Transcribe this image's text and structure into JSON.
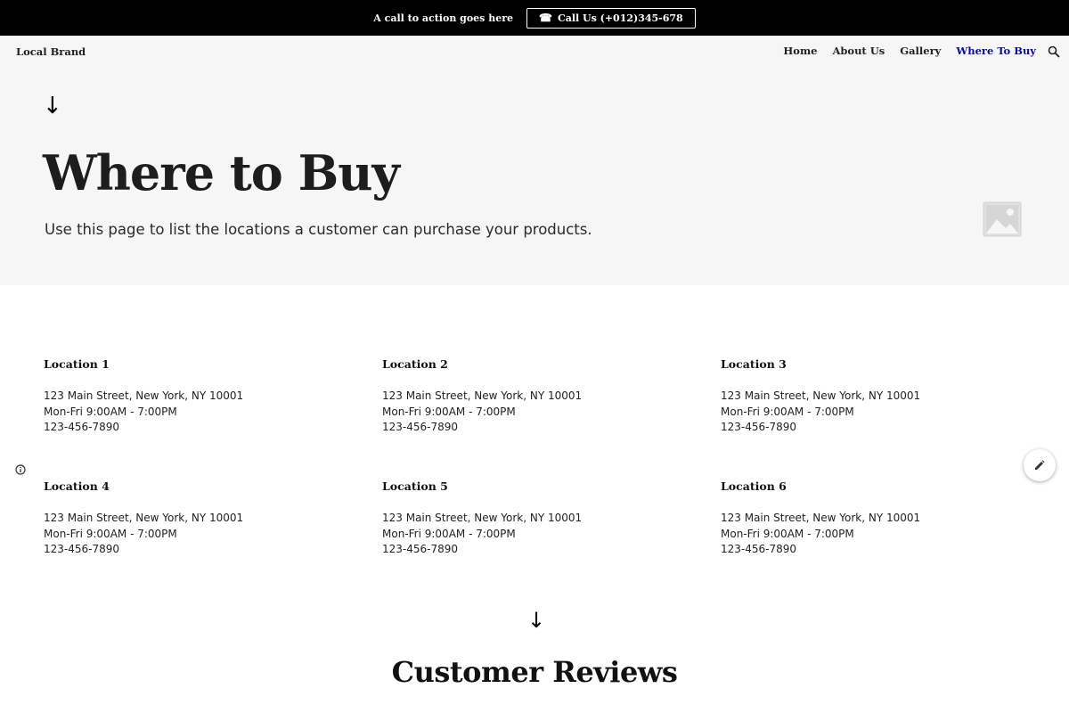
{
  "topbar": {
    "cta_text": "A call to action goes here",
    "call_label": "Call Us (+012)345-678",
    "phone_icon": "☎"
  },
  "header": {
    "brand": "Local Brand",
    "nav": [
      "Home",
      "About Us",
      "Gallery",
      "Where To Buy"
    ],
    "active_nav": "Where To Buy",
    "active_color": "#0b0b9e"
  },
  "hero": {
    "arrow": "↓",
    "title": "Where to Buy",
    "subtitle": "Use this page to list the locations a customer can purchase your products."
  },
  "locations": [
    {
      "name": "Location 1",
      "address": "123 Main Street, New York, NY 10001",
      "hours": "Mon-Fri 9:00AM - 7:00PM",
      "phone": "123-456-7890"
    },
    {
      "name": "Location 2",
      "address": "123 Main Street, New York, NY 10001",
      "hours": "Mon-Fri 9:00AM - 7:00PM",
      "phone": "123-456-7890"
    },
    {
      "name": "Location 3",
      "address": "123 Main Street, New York, NY 10001",
      "hours": "Mon-Fri 9:00AM - 7:00PM",
      "phone": "123-456-7890"
    },
    {
      "name": "Location 4",
      "address": "123 Main Street, New York, NY 10001",
      "hours": "Mon-Fri 9:00AM - 7:00PM",
      "phone": "123-456-7890"
    },
    {
      "name": "Location 5",
      "address": "123 Main Street, New York, NY 10001",
      "hours": "Mon-Fri 9:00AM - 7:00PM",
      "phone": "123-456-7890"
    },
    {
      "name": "Location 6",
      "address": "123 Main Street, New York, NY 10001",
      "hours": "Mon-Fri 9:00AM - 7:00PM",
      "phone": "123-456-7890"
    }
  ],
  "reviews": {
    "arrow": "↓",
    "title": "Customer Reviews"
  },
  "icons": {
    "search": "search-icon",
    "image_placeholder": "image-placeholder-icon",
    "info": "info-icon",
    "edit": "pencil-icon"
  }
}
